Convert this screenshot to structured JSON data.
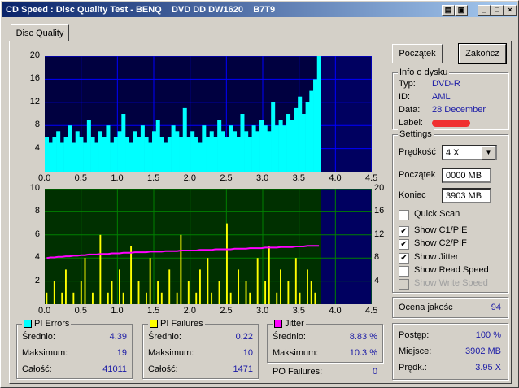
{
  "window": {
    "title": "CD Speed : Disc Quality Test - BENQ    DVD DD DW1620    B7T9",
    "controls": [
      "min",
      "max",
      "close"
    ]
  },
  "tab": {
    "label": "Disc Quality"
  },
  "buttons": {
    "start": "Początek",
    "end": "Zakończ"
  },
  "disc_info": {
    "title": "Info o dysku",
    "type_label": "Typ:",
    "type_value": "DVD-R",
    "id_label": "ID:",
    "id_value": "AML",
    "date_label": "Data:",
    "date_value": "28 December",
    "label_label": "Label:"
  },
  "settings": {
    "title": "Settings",
    "speed_label": "Prędkość",
    "speed_value": "4 X",
    "start_label": "Początek",
    "start_value": "0000 MB",
    "end_label": "Koniec",
    "end_value": "3903 MB",
    "checks": [
      {
        "label": "Quick Scan",
        "checked": false,
        "disabled": false
      },
      {
        "label": "Show C1/PIE",
        "checked": true,
        "disabled": false
      },
      {
        "label": "Show C2/PIF",
        "checked": true,
        "disabled": false
      },
      {
        "label": "Show Jitter",
        "checked": true,
        "disabled": false
      },
      {
        "label": "Show Read Speed",
        "checked": false,
        "disabled": false
      },
      {
        "label": "Show Write Speed",
        "checked": false,
        "disabled": true
      }
    ]
  },
  "quality": {
    "label": "Ocena jakośc",
    "value": "94"
  },
  "progress": {
    "progress_label": "Postęp:",
    "progress_value": "100 %",
    "position_label": "Miejsce:",
    "position_value": "3902 MB",
    "speed_label": "Prędk.:",
    "speed_value": "3.95 X"
  },
  "pi_errors": {
    "title": "PI Errors",
    "color": "#00ffff",
    "avg_label": "Średnio:",
    "avg": "4.39",
    "max_label": "Maksimum:",
    "max": "19",
    "total_label": "Całość:",
    "total": "41011"
  },
  "pi_failures": {
    "title": "PI Failures",
    "color": "#ffff00",
    "avg_label": "Średnio:",
    "avg": "0.22",
    "max_label": "Maksimum:",
    "max": "10",
    "total_label": "Całość:",
    "total": "1471"
  },
  "jitter": {
    "title": "Jitter",
    "color": "#ff00ff",
    "avg_label": "Średnio:",
    "avg": "8.83 %",
    "max_label": "Maksimum:",
    "max": "10.3 %"
  },
  "po_failures": {
    "label": "PO Failures:",
    "value": "0"
  },
  "colors": {
    "pie": "#00ffff",
    "pif": "#ffff00",
    "jitter": "#ff00ff",
    "plot_bg_top": "#000040",
    "plot_bg_bottom": "#003000",
    "grid": "#0000ff",
    "grid_bottom": "#008000"
  },
  "chart_data": [
    {
      "type": "area",
      "series": [
        {
          "name": "PI Errors",
          "values": [
            6,
            5,
            6,
            7,
            5,
            6,
            8,
            5,
            7,
            6,
            5,
            9,
            6,
            5,
            7,
            6,
            8,
            5,
            6,
            7,
            10,
            6,
            5,
            7,
            6,
            8,
            6,
            5,
            7,
            9,
            6,
            5,
            6,
            8,
            7,
            6,
            11,
            6,
            7,
            6,
            5,
            8,
            6,
            7,
            6,
            9,
            7,
            6,
            8,
            7,
            6,
            10,
            7,
            6,
            8,
            7,
            9,
            8,
            7,
            12,
            8,
            9,
            8,
            10,
            9,
            11,
            13,
            10,
            12,
            14,
            16,
            20
          ]
        }
      ],
      "x_range": [
        0,
        3.8
      ],
      "xlim": [
        0,
        4.5
      ],
      "ylim": [
        0,
        20
      ],
      "x_ticks": [
        "0.0",
        "0.5",
        "1.0",
        "1.5",
        "2.0",
        "2.5",
        "3.0",
        "3.5",
        "4.0",
        "4.5"
      ],
      "y_ticks": [
        "4",
        "8",
        "12",
        "16",
        "20"
      ]
    },
    {
      "type": "bar",
      "series": [
        {
          "name": "PI Failures",
          "values": [
            1,
            0,
            2,
            0,
            1,
            3,
            0,
            1,
            0,
            2,
            4,
            0,
            1,
            0,
            6,
            0,
            1,
            2,
            0,
            3,
            1,
            0,
            5,
            0,
            2,
            0,
            1,
            4,
            0,
            2,
            1,
            0,
            3,
            0,
            1,
            6,
            0,
            2,
            0,
            1,
            3,
            0,
            4,
            1,
            0,
            2,
            0,
            7,
            1,
            0,
            3,
            0,
            2,
            1,
            0,
            4,
            0,
            2,
            5,
            0,
            1,
            3,
            0,
            2,
            0,
            4,
            1,
            0,
            3,
            2,
            1,
            0
          ]
        },
        {
          "name": "Jitter",
          "values": [
            8.0,
            8.1,
            8.1,
            8.2,
            8.2,
            8.3,
            8.3,
            8.4,
            8.4,
            8.5,
            8.5,
            8.6,
            8.6,
            8.6,
            8.7,
            8.7,
            8.7,
            8.8,
            8.8,
            8.8,
            8.9,
            8.9,
            8.9,
            9.0,
            9.0,
            9.0,
            9.0,
            9.1,
            9.1,
            9.1,
            9.1,
            9.2,
            9.2,
            9.2,
            9.2,
            9.3,
            9.3,
            9.3,
            9.3,
            9.3,
            9.4,
            9.4,
            9.4,
            9.4,
            9.5,
            9.5,
            9.5,
            9.5,
            9.5,
            9.6,
            9.6,
            9.6,
            9.6,
            9.7,
            9.7,
            9.7,
            9.7,
            9.8,
            9.8,
            9.8,
            9.8,
            9.9,
            9.9,
            9.9,
            9.9,
            10.0,
            10.0,
            10.0,
            10.1,
            10.1,
            10.1,
            10.1
          ]
        }
      ],
      "x_range": [
        0,
        3.8
      ],
      "xlim": [
        0,
        4.5
      ],
      "ylim": [
        0,
        10
      ],
      "y2lim": [
        0,
        20
      ],
      "x_ticks": [
        "0.0",
        "0.5",
        "1.0",
        "1.5",
        "2.0",
        "2.5",
        "3.0",
        "3.5",
        "4.0",
        "4.5"
      ],
      "y_ticks": [
        "2",
        "4",
        "6",
        "8",
        "10"
      ],
      "y2_ticks": [
        "4",
        "8",
        "12",
        "16",
        "20"
      ]
    }
  ]
}
